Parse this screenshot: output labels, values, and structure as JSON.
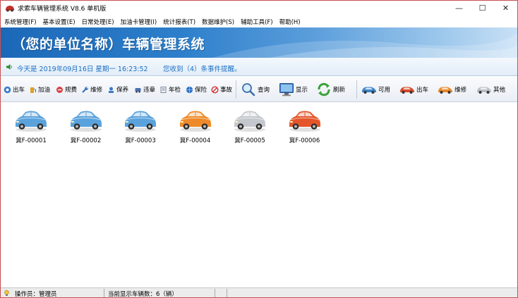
{
  "window": {
    "title": "求索车辆管理系统 V8.6 单机版",
    "controls": {
      "minimize": "—",
      "maximize": "☐",
      "close": "✕"
    }
  },
  "menu": [
    "系统管理(F)",
    "基本设置(E)",
    "日常处理(E)",
    "加油卡管理(I)",
    "统计报表(T)",
    "数据维护(S)",
    "辅助工具(F)",
    "帮助(H)"
  ],
  "banner": {
    "title": "（您的单位名称）车辆管理系统"
  },
  "notice": {
    "date_text": "今天是 2019年09月16日 星期一 16:23:52",
    "message": "您收到（4）条事件提醒。"
  },
  "toolbar": {
    "left": [
      {
        "label": "出车",
        "icon": "car-out-icon"
      },
      {
        "label": "加油",
        "icon": "fuel-icon"
      },
      {
        "label": "规费",
        "icon": "fee-icon"
      },
      {
        "label": "维修",
        "icon": "wrench-icon"
      },
      {
        "label": "保养",
        "icon": "maintenance-icon"
      },
      {
        "label": "违章",
        "icon": "violation-icon"
      },
      {
        "label": "年检",
        "icon": "inspection-icon"
      },
      {
        "label": "保险",
        "icon": "insurance-icon"
      },
      {
        "label": "事故",
        "icon": "accident-icon"
      }
    ],
    "middle": [
      {
        "label": "查询",
        "icon": "search-icon"
      },
      {
        "label": "显示",
        "icon": "monitor-icon"
      },
      {
        "label": "刷新",
        "icon": "refresh-icon"
      }
    ],
    "filters": [
      {
        "label": "可用",
        "icon": "car-blue-icon",
        "color": "#3d85c8"
      },
      {
        "label": "出车",
        "icon": "car-red-icon",
        "color": "#d64a2a"
      },
      {
        "label": "维修",
        "icon": "car-orange-icon",
        "color": "#e8892a"
      },
      {
        "label": "其他",
        "icon": "car-silver-icon",
        "color": "#b9bec6"
      }
    ]
  },
  "vehicles": [
    {
      "plate": "冀F-00001",
      "color": "#5aa2dc"
    },
    {
      "plate": "冀F-00002",
      "color": "#5aa2dc"
    },
    {
      "plate": "冀F-00003",
      "color": "#5aa2dc"
    },
    {
      "plate": "冀F-00004",
      "color": "#ee8a2a"
    },
    {
      "plate": "冀F-00005",
      "color": "#c4c8ce"
    },
    {
      "plate": "冀F-00006",
      "color": "#e4552a"
    }
  ],
  "status": {
    "operator": "操作员：管理员",
    "vehicle_count": "当前显示车辆数：6（辆）"
  }
}
